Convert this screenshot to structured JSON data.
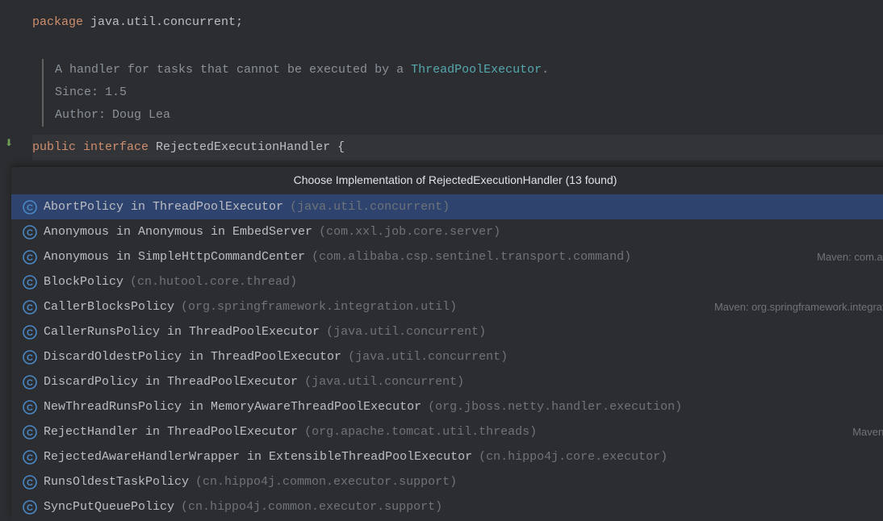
{
  "code": {
    "package_kw": "package",
    "package_name": " java.util.concurrent;",
    "javadoc": {
      "desc_prefix": "A handler for tasks that cannot be executed by a ",
      "desc_link": "ThreadPoolExecutor",
      "desc_suffix": ".",
      "since_label": "Since:",
      "since_value": "1.5",
      "author_label": "Author:",
      "author_value": "Doug Lea"
    },
    "decl": {
      "public_kw": "public",
      "interface_kw": "interface",
      "name": " RejectedExecutionHandler {"
    }
  },
  "popup": {
    "title": "Choose Implementation of RejectedExecutionHandler (13 found)",
    "items": [
      {
        "name": "AbortPolicy in ThreadPoolExecutor",
        "pkg": "(java.util.concurrent)",
        "maven": "",
        "selected": true
      },
      {
        "name": "Anonymous in Anonymous in EmbedServer",
        "pkg": "(com.xxl.job.core.server)",
        "maven": "",
        "selected": false
      },
      {
        "name": "Anonymous in SimpleHttpCommandCenter",
        "pkg": "(com.alibaba.csp.sentinel.transport.command)",
        "maven": "Maven: com.aliba",
        "selected": false
      },
      {
        "name": "BlockPolicy",
        "pkg": "(cn.hutool.core.thread)",
        "maven": "",
        "selected": false
      },
      {
        "name": "CallerBlocksPolicy",
        "pkg": "(org.springframework.integration.util)",
        "maven": "Maven: org.springframework.integration",
        "selected": false
      },
      {
        "name": "CallerRunsPolicy in ThreadPoolExecutor",
        "pkg": "(java.util.concurrent)",
        "maven": "",
        "selected": false
      },
      {
        "name": "DiscardOldestPolicy in ThreadPoolExecutor",
        "pkg": "(java.util.concurrent)",
        "maven": "",
        "selected": false
      },
      {
        "name": "DiscardPolicy in ThreadPoolExecutor",
        "pkg": "(java.util.concurrent)",
        "maven": "",
        "selected": false
      },
      {
        "name": "NewThreadRunsPolicy in MemoryAwareThreadPoolExecutor",
        "pkg": "(org.jboss.netty.handler.execution)",
        "maven": "",
        "selected": false
      },
      {
        "name": "RejectHandler in ThreadPoolExecutor",
        "pkg": "(org.apache.tomcat.util.threads)",
        "maven": "Maven: or",
        "selected": false
      },
      {
        "name": "RejectedAwareHandlerWrapper in ExtensibleThreadPoolExecutor",
        "pkg": "(cn.hippo4j.core.executor)",
        "maven": "",
        "selected": false
      },
      {
        "name": "RunsOldestTaskPolicy",
        "pkg": "(cn.hippo4j.common.executor.support)",
        "maven": "",
        "selected": false
      },
      {
        "name": "SyncPutQueuePolicy",
        "pkg": "(cn.hippo4j.common.executor.support)",
        "maven": "",
        "selected": false
      }
    ]
  }
}
